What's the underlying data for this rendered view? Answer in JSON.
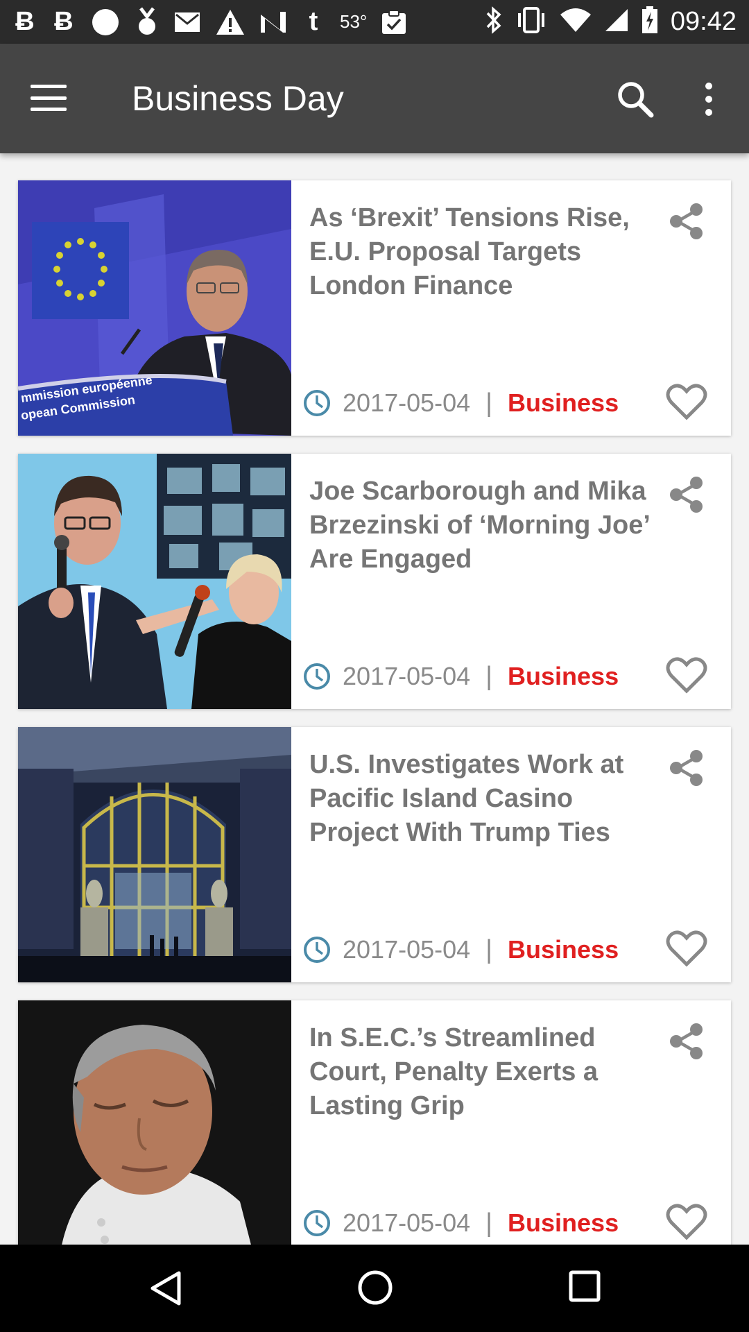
{
  "status_bar": {
    "icons": [
      "bitcoin-icon",
      "bitcoin-icon",
      "circle-icon",
      "medal-icon",
      "mail-icon",
      "warning-icon",
      "n-icon",
      "tumblr-icon",
      "weather-icon",
      "clipboard-icon",
      "bluetooth-icon",
      "vibrate-icon",
      "wifi-icon",
      "signal-icon",
      "battery-icon"
    ],
    "temperature": "53°",
    "time": "09:42"
  },
  "app_bar": {
    "title": "Business Day"
  },
  "articles": [
    {
      "title": "As ‘Brexit’ Tensions Rise, E.U. Proposal Targets London Finance",
      "date": "2017-05-04",
      "category": "Business",
      "image_caption": "mmission européenne / opean Commission"
    },
    {
      "title": "Joe Scarborough and Mika Brzezinski of ‘Morning Joe’ Are Engaged",
      "date": "2017-05-04",
      "category": "Business"
    },
    {
      "title": "U.S. Investigates Work at Pacific Island Casino Project With Trump Ties",
      "date": "2017-05-04",
      "category": "Business"
    },
    {
      "title": "In S.E.C.’s Streamlined Court, Penalty Exerts a Lasting Grip",
      "date": "2017-05-04",
      "category": "Business"
    }
  ],
  "colors": {
    "category": "#e02020",
    "clock": "#4a8aa8",
    "app_bar": "#454545",
    "status_bar": "#2b2b2b"
  },
  "separator": "|"
}
